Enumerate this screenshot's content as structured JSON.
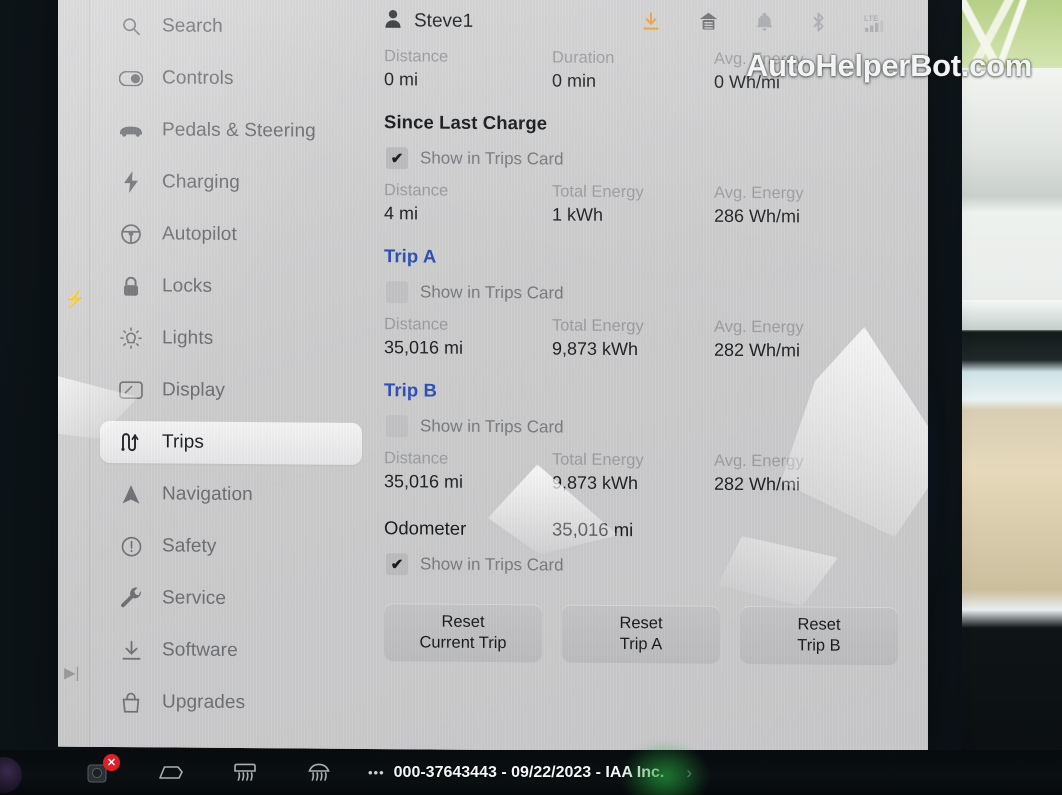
{
  "sidebar": {
    "items": [
      {
        "label": "Search",
        "icon": "search-icon",
        "active": false
      },
      {
        "label": "Controls",
        "icon": "toggle-icon",
        "active": false
      },
      {
        "label": "Pedals & Steering",
        "icon": "car-icon",
        "active": false
      },
      {
        "label": "Charging",
        "icon": "bolt-icon",
        "active": false
      },
      {
        "label": "Autopilot",
        "icon": "steering-icon",
        "active": false
      },
      {
        "label": "Locks",
        "icon": "lock-icon",
        "active": false
      },
      {
        "label": "Lights",
        "icon": "lightbulb-icon",
        "active": false
      },
      {
        "label": "Display",
        "icon": "display-icon",
        "active": false
      },
      {
        "label": "Trips",
        "icon": "trips-icon",
        "active": true
      },
      {
        "label": "Navigation",
        "icon": "navigation-icon",
        "active": false
      },
      {
        "label": "Safety",
        "icon": "alert-icon",
        "active": false
      },
      {
        "label": "Service",
        "icon": "wrench-icon",
        "active": false
      },
      {
        "label": "Software",
        "icon": "download-icon",
        "active": false
      },
      {
        "label": "Upgrades",
        "icon": "bag-icon",
        "active": false
      }
    ]
  },
  "statusbar": {
    "account_name": "Steve1",
    "account_icon": "person-icon",
    "icons": [
      {
        "name": "software-update-icon",
        "color": "#e8a33d"
      },
      {
        "name": "garage-home-icon",
        "color": "#6d6e72"
      },
      {
        "name": "bell-icon",
        "color": "#a9aaae"
      },
      {
        "name": "bluetooth-icon",
        "color": "#a9aaae"
      },
      {
        "name": "lte-signal-icon",
        "color": "#a9aaae",
        "label": "LTE"
      }
    ]
  },
  "current_trip": {
    "stats": [
      {
        "key": "Distance",
        "value": "0 mi"
      },
      {
        "key": "Duration",
        "value": "0 min"
      },
      {
        "key": "Avg. Energy",
        "value": "0 Wh/mi"
      }
    ]
  },
  "sections": [
    {
      "title": "Since Last Charge",
      "title_is_link": false,
      "checkbox": {
        "label": "Show in Trips Card",
        "checked": true
      },
      "stats": [
        {
          "key": "Distance",
          "value": "4 mi"
        },
        {
          "key": "Total Energy",
          "value": "1 kWh"
        },
        {
          "key": "Avg. Energy",
          "value": "286 Wh/mi"
        }
      ]
    },
    {
      "title": "Trip A",
      "title_is_link": true,
      "checkbox": {
        "label": "Show in Trips Card",
        "checked": false
      },
      "stats": [
        {
          "key": "Distance",
          "value": "35,016 mi"
        },
        {
          "key": "Total Energy",
          "value": "9,873 kWh"
        },
        {
          "key": "Avg. Energy",
          "value": "282 Wh/mi"
        }
      ]
    },
    {
      "title": "Trip B",
      "title_is_link": true,
      "checkbox": {
        "label": "Show in Trips Card",
        "checked": false
      },
      "stats": [
        {
          "key": "Distance",
          "value": "35,016 mi"
        },
        {
          "key": "Total Energy",
          "value": "9,873 kWh"
        },
        {
          "key": "Avg. Energy",
          "value": "282 Wh/mi"
        }
      ]
    }
  ],
  "odometer": {
    "label": "Odometer",
    "value": "35,016 mi",
    "checkbox": {
      "label": "Show in Trips Card",
      "checked": true
    }
  },
  "reset_buttons": [
    {
      "line1": "Reset",
      "line2": "Current Trip"
    },
    {
      "line1": "Reset",
      "line2": "Trip A"
    },
    {
      "line1": "Reset",
      "line2": "Trip B"
    }
  ],
  "watermark": "AutoHelperBot.com",
  "bottom_bar": {
    "icons": [
      {
        "name": "media-dial-icon"
      },
      {
        "name": "camera-icon",
        "badge": "✕"
      },
      {
        "name": "wiper-icon"
      },
      {
        "name": "rear-defrost-icon"
      },
      {
        "name": "front-defrost-icon"
      }
    ],
    "dots": "•••",
    "text": "000-37643443 - 09/22/2023 - IAA Inc.",
    "chevron": "›"
  },
  "colors": {
    "screen_bg": "#cfcfd1",
    "link_blue": "#2d4fb6",
    "text_primary": "#17191c",
    "text_muted": "#9b9ca0",
    "accent_orange": "#e8a33d"
  }
}
